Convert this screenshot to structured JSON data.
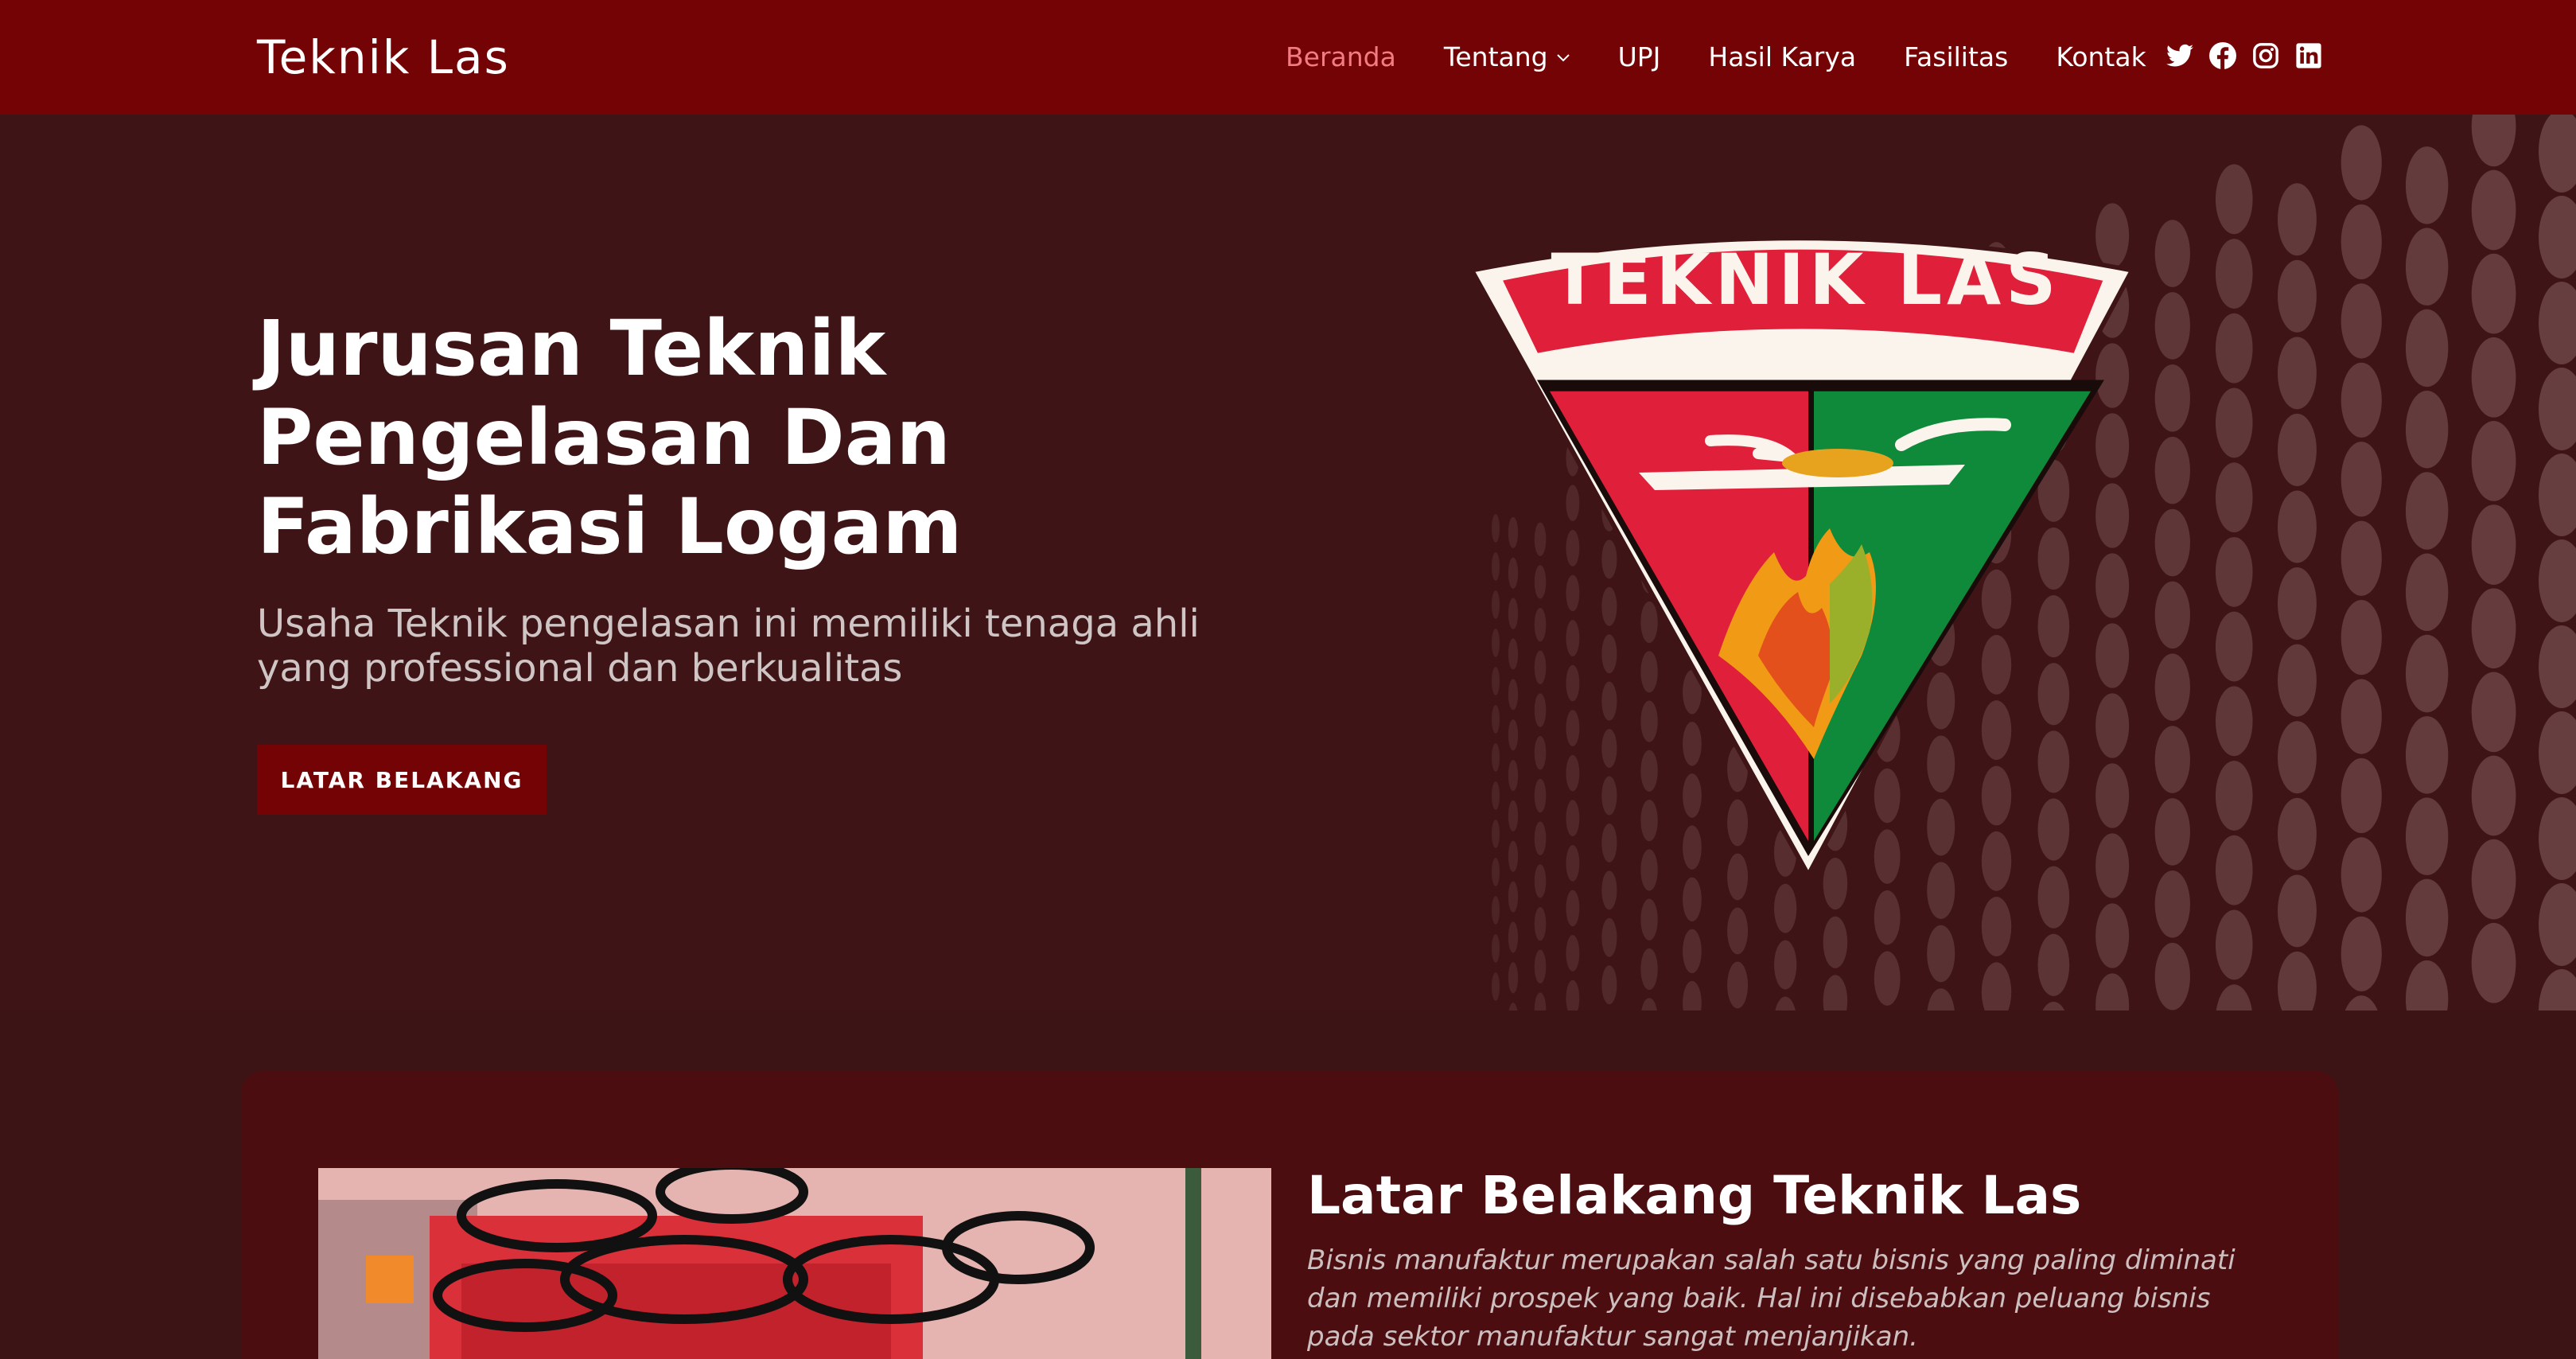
{
  "header": {
    "logo": "Teknik Las",
    "nav": [
      {
        "label": "Beranda",
        "active": true
      },
      {
        "label": "Tentang",
        "dropdown": true
      },
      {
        "label": "UPJ"
      },
      {
        "label": "Hasil Karya"
      },
      {
        "label": "Fasilitas"
      },
      {
        "label": "Kontak"
      }
    ],
    "socials": [
      "twitter-icon",
      "facebook-icon",
      "instagram-icon",
      "linkedin-icon"
    ]
  },
  "hero": {
    "title": "Jurusan Teknik Pengelasan Dan Fabrikasi Logam",
    "subtitle": "Usaha Teknik pengelasan ini memiliki tenaga ahli yang professional dan berkualitas",
    "button": "LATAR BELAKANG",
    "emblem_text": "TEKNIK LAS"
  },
  "about": {
    "title": "Latar Belakang Teknik Las",
    "text": "Bisnis manufaktur merupakan salah satu bisnis yang paling diminati dan memiliki prospek yang baik. Hal ini disebabkan peluang bisnis pada sektor manufaktur sangat menjanjikan."
  },
  "colors": {
    "header_bg": "#740305",
    "hero_bg": "#3e1416",
    "accent_active": "#f27c82",
    "card_bg": "#4b0d10"
  }
}
